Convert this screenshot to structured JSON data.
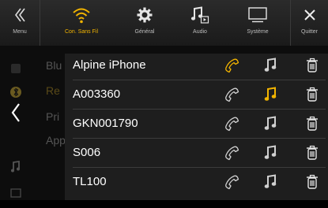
{
  "topbar": {
    "menu_label": "Menu",
    "wifi_label": "Con. Sans Fil",
    "general_label": "Général",
    "audio_label": "Audio",
    "system_label": "Système",
    "quit_label": "Quitter"
  },
  "background_list": {
    "items": [
      "Blu",
      "Re",
      "Pri",
      "App"
    ]
  },
  "devices": [
    {
      "name": "Alpine iPhone",
      "phone_active": true,
      "audio_active": false
    },
    {
      "name": "A003360",
      "phone_active": false,
      "audio_active": true
    },
    {
      "name": "GKN001790",
      "phone_active": false,
      "audio_active": false
    },
    {
      "name": "S006",
      "phone_active": false,
      "audio_active": false
    },
    {
      "name": "TL100",
      "phone_active": false,
      "audio_active": false
    }
  ],
  "colors": {
    "accent": "#f2b400",
    "text": "#ffffff",
    "inactive_icon": "#d0d0d0"
  }
}
